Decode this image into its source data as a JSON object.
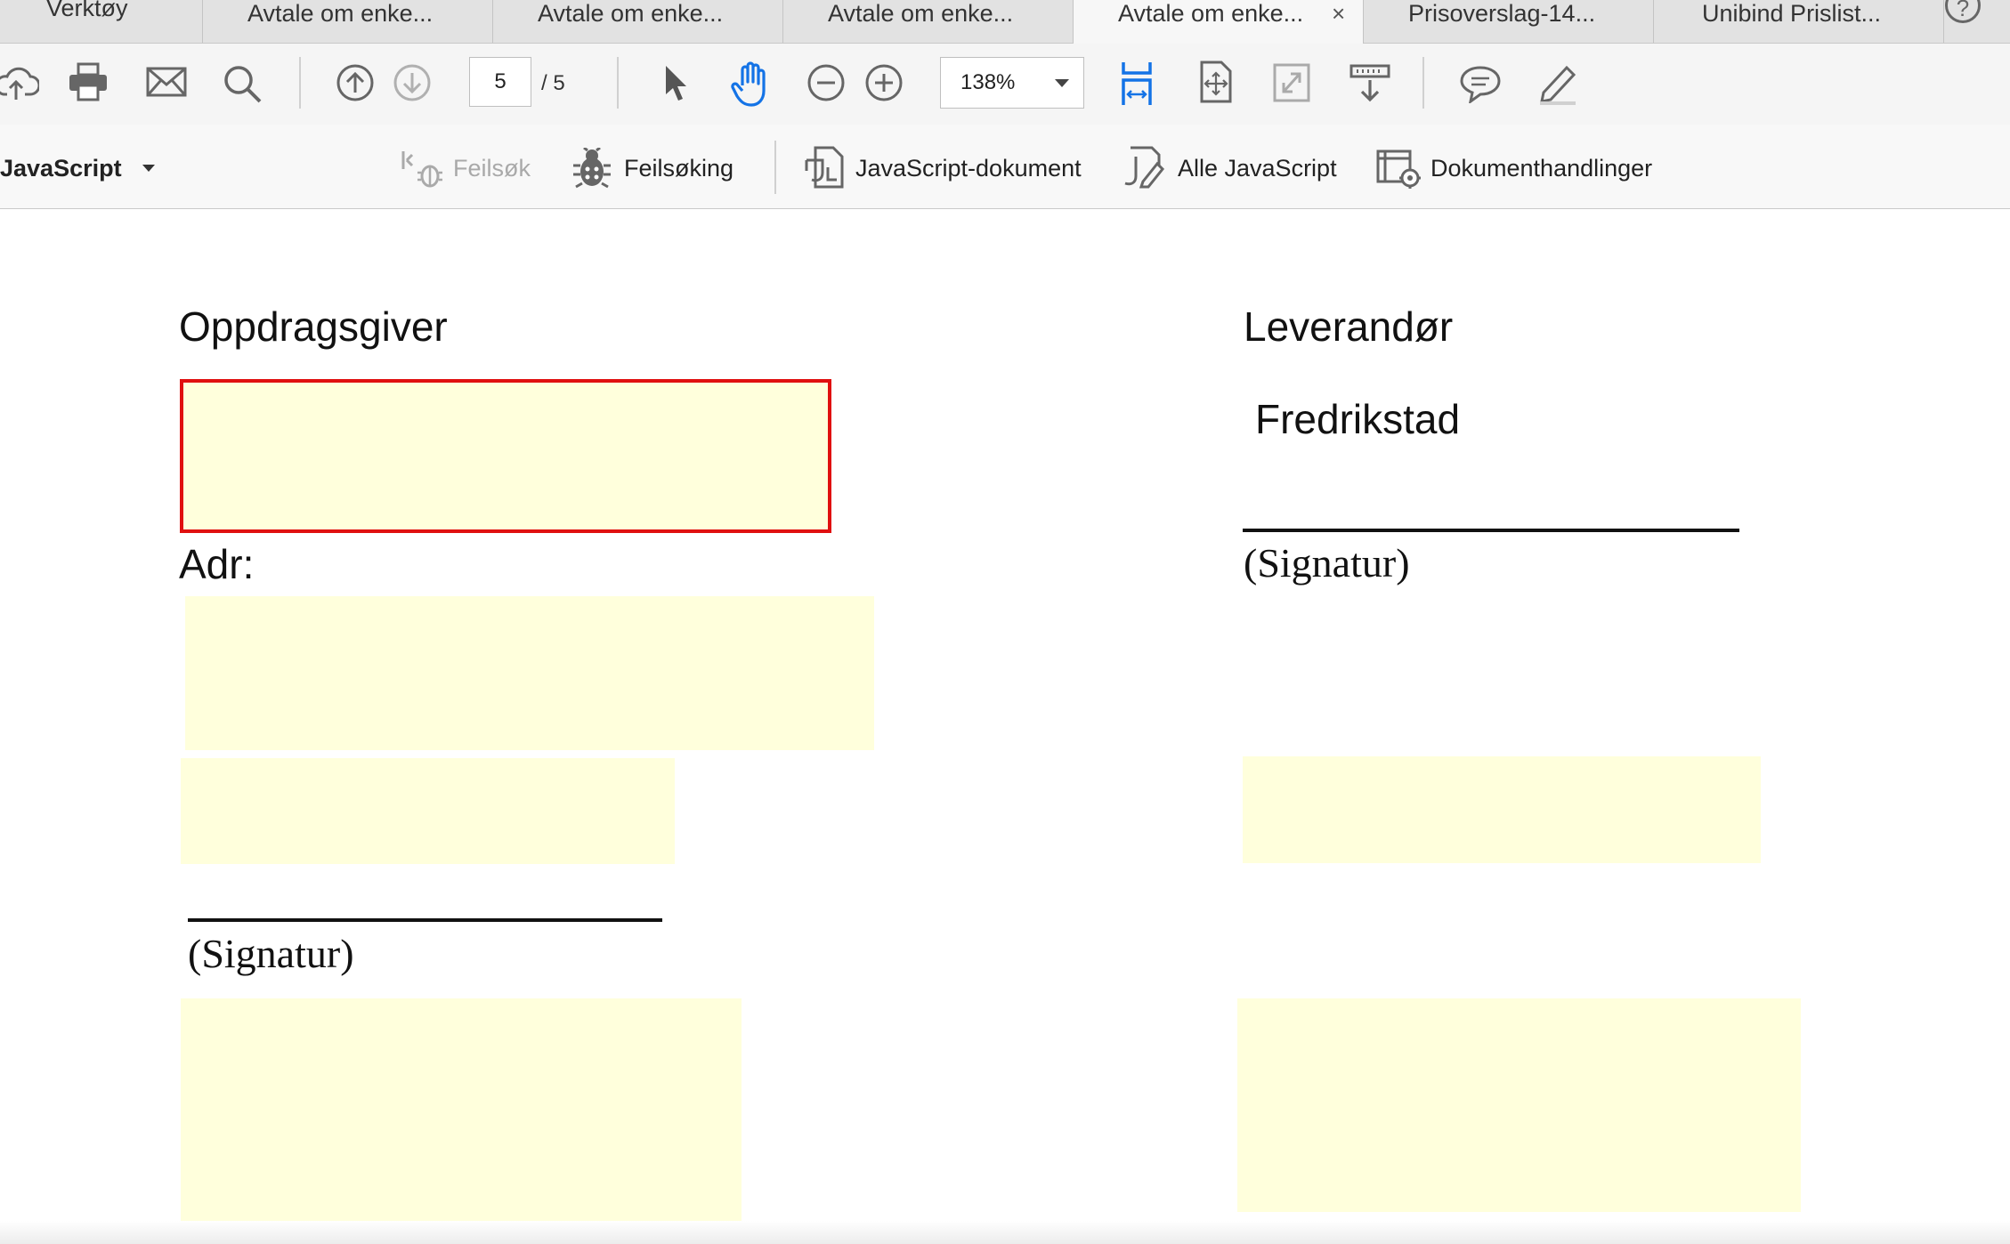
{
  "tabs": [
    {
      "label": "Verktøy",
      "active": false
    },
    {
      "label": "Avtale om enke...",
      "active": false
    },
    {
      "label": "Avtale om enke...",
      "active": false
    },
    {
      "label": "Avtale om enke...",
      "active": false
    },
    {
      "label": "Avtale om enke...",
      "active": true,
      "close": "×"
    },
    {
      "label": "Prisoverslag-14...",
      "active": false
    },
    {
      "label": "Unibind Prislist...",
      "active": false
    }
  ],
  "help_icon": "?",
  "toolbar": {
    "icons": [
      "upload-cloud-icon",
      "print-icon",
      "mail-icon",
      "search-icon",
      "page-up-icon",
      "page-down-icon",
      "select-cursor-icon",
      "hand-icon",
      "zoom-out-icon",
      "zoom-in-icon",
      "fit-width-icon",
      "fit-page-icon",
      "fullscreen-icon",
      "read-mode-icon",
      "comment-icon",
      "highlight-pen-icon"
    ],
    "page_current": "5",
    "page_total": "/ 5",
    "zoom": "138%"
  },
  "js_toolbar": {
    "menu_label": "JavaScript",
    "debug_step": "Feilsøk",
    "debugger": "Feilsøking",
    "document_js": "JavaScript-dokument",
    "all_js": "Alle JavaScript",
    "document_actions": "Dokumenthandlinger"
  },
  "document": {
    "client_heading": "Oppdragsgiver",
    "address_label": "Adr:",
    "signature_left": "(Signatur)",
    "supplier_heading": "Leverandør",
    "supplier_city": "Fredrikstad",
    "signature_right": "(Signatur)"
  },
  "colors": {
    "field_fill": "#ffffdc",
    "focus_border": "#e01010",
    "accent_blue": "#1473e6"
  }
}
